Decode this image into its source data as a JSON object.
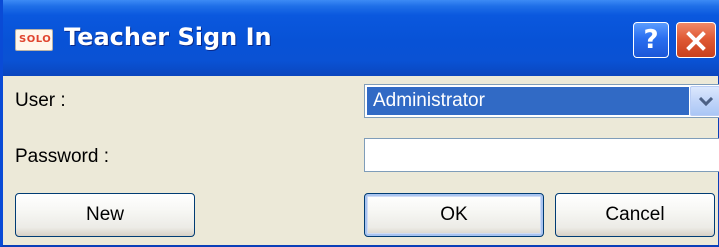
{
  "window": {
    "title": "Teacher Sign In",
    "app_icon_text": "SOLO",
    "help_label": "?"
  },
  "form": {
    "user_label": "User :",
    "user_value": "Administrator",
    "password_label": "Password :",
    "password_value": ""
  },
  "buttons": {
    "new_label": "New",
    "ok_label": "OK",
    "cancel_label": "Cancel"
  },
  "colors": {
    "titlebar": "#0852d6",
    "selection": "#316ac5",
    "close": "#e05a35",
    "dialog_bg": "#ece9d8"
  }
}
